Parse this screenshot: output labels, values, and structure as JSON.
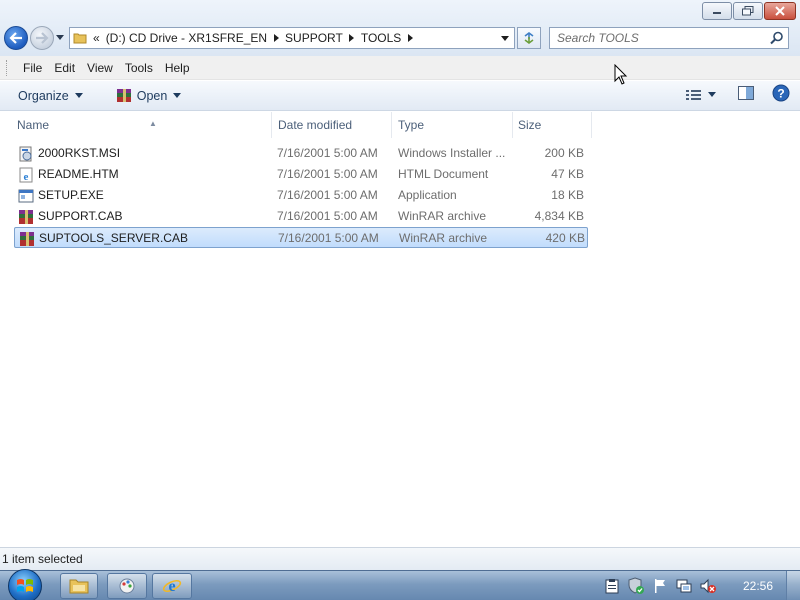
{
  "window": {
    "controls": {
      "minimize_icon": "minimize-icon",
      "maximize_icon": "restore-icon",
      "close_icon": "close-icon"
    }
  },
  "nav": {
    "address_prefix": "«",
    "breadcrumb": [
      "(D:) CD Drive - XR1SFRE_EN",
      "SUPPORT",
      "TOOLS"
    ],
    "search_placeholder": "Search TOOLS"
  },
  "menubar": {
    "items": [
      "File",
      "Edit",
      "View",
      "Tools",
      "Help"
    ]
  },
  "commandbar": {
    "organize_label": "Organize",
    "open_label": "Open"
  },
  "columns": {
    "name": "Name",
    "date": "Date modified",
    "type": "Type",
    "size": "Size"
  },
  "files": [
    {
      "name": "2000RKST.MSI",
      "date": "7/16/2001 5:00 AM",
      "type": "Windows Installer ...",
      "size": "200 KB",
      "icon": "msi-icon",
      "selected": false
    },
    {
      "name": "README.HTM",
      "date": "7/16/2001 5:00 AM",
      "type": "HTML Document",
      "size": "47 KB",
      "icon": "ie-document-icon",
      "selected": false
    },
    {
      "name": "SETUP.EXE",
      "date": "7/16/2001 5:00 AM",
      "type": "Application",
      "size": "18 KB",
      "icon": "application-icon",
      "selected": false
    },
    {
      "name": "SUPPORT.CAB",
      "date": "7/16/2001 5:00 AM",
      "type": "WinRAR archive",
      "size": "4,834 KB",
      "icon": "winrar-icon",
      "selected": false
    },
    {
      "name": "SUPTOOLS_SERVER.CAB",
      "date": "7/16/2001 5:00 AM",
      "type": "WinRAR archive",
      "size": "420 KB",
      "icon": "winrar-icon",
      "selected": true
    }
  ],
  "statusbar": {
    "text": "1 item selected"
  },
  "taskbar": {
    "clock": "22:56"
  },
  "colors": {
    "selection_fill": "#c9e0fc",
    "selection_border": "#7da2ce",
    "accent": "#1d5cbf"
  }
}
